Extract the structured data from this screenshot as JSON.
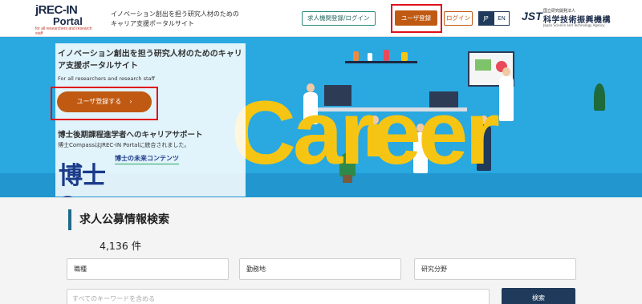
{
  "header": {
    "logo": {
      "line1": "jREC-IN",
      "line2": "Portal",
      "line3": "for all researchers and research staff"
    },
    "tagline_line1": "イノベーション創出を担う研究人材のための",
    "tagline_line2": "キャリア支援ポータルサイト",
    "org_button": "求人機関登録/ログイン",
    "register_button": "ユーザ登録",
    "login_button": "ログイン",
    "lang_jp": "JP",
    "lang_en": "EN",
    "jst": {
      "mark": "JST",
      "small": "国立研究開発法人",
      "name": "科学技術振興機構",
      "eng": "Japan Science and Technology Agency"
    }
  },
  "hero": {
    "title": "イノベーション創出を担う研究人材のためのキャリア支援ポータルサイト",
    "subtitle": "For all researchers and research staff",
    "register_button": "ユーザ登録する",
    "chevron": "›",
    "doctor_title": "博士後期課程進学者へのキャリアサポート",
    "doctor_sub": "博士CompassはJREC-IN Portalに統合されました。",
    "compass_small": "博士の未来コンテンツ",
    "compass_main": "博士Compass",
    "career_text": "Career"
  },
  "search": {
    "title": "求人公募情報検索",
    "count": "4,136 件",
    "select_job": "職種",
    "select_location": "勤務地",
    "select_field": "研究分野",
    "keyword_placeholder": "すべてのキーワードを含める",
    "search_button": "検索"
  },
  "colors": {
    "accent": "#c05a12",
    "navy": "#1f3a5a",
    "hero_bg": "#2aa8e0",
    "career": "#f6c514",
    "highlight": "#e0101a"
  }
}
